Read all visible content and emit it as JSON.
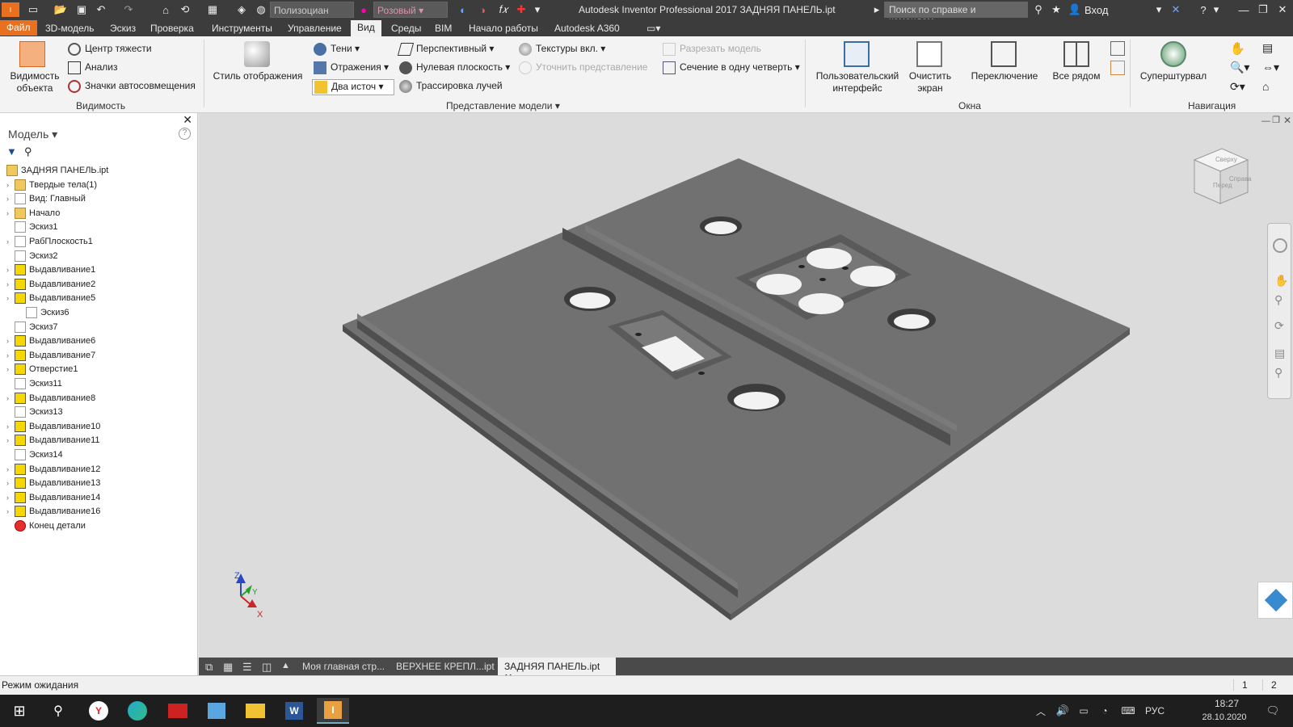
{
  "titlebar": {
    "title": "Autodesk Inventor Professional 2017   ЗАДНЯЯ ПАНЕЛЬ.ipt",
    "material": "Полизоциан",
    "appearance": "Розовый",
    "search_placeholder": "Поиск по справке и командам...",
    "login": "Вход"
  },
  "menu": {
    "tabs": [
      "Файл",
      "3D-модель",
      "Эскиз",
      "Проверка",
      "Инструменты",
      "Управление",
      "Вид",
      "Среды",
      "BIM",
      "Начало работы",
      "Autodesk A360"
    ],
    "active": "Вид"
  },
  "ribbon": {
    "visibility": {
      "object_vis": "Видимость объекта",
      "center_gravity": "Центр тяжести",
      "analysis": "Анализ",
      "autolimits": "Значки автосовмещения",
      "group": "Видимость"
    },
    "display": {
      "style": "Стиль отображения",
      "shadows": "Тени",
      "reflections": "Отражения",
      "lights": "Два источ",
      "perspective": "Перспективный",
      "ground": "Нулевая плоскость",
      "raytrace": "Трассировка лучей",
      "textures": "Текстуры вкл.",
      "refine": "Уточнить представление",
      "half_section": "Разрезать модель",
      "quarter_section": "Сечение в одну четверть",
      "group": "Представление модели"
    },
    "windows": {
      "user_interface": "Пользовательский интерфейс",
      "clean_screen": "Очистить экран",
      "switch": "Переключение",
      "tile": "Все рядом",
      "group": "Окна"
    },
    "navigation": {
      "steering": "Суперштурвал",
      "group": "Навигация"
    }
  },
  "browser": {
    "title": "Модель",
    "items": [
      {
        "label": "ЗАДНЯЯ ПАНЕЛЬ.ipt",
        "icon": "part-icon",
        "exp": false
      },
      {
        "label": "Твердые тела(1)",
        "icon": "folder-icon",
        "exp": true
      },
      {
        "label": "Вид: Главный",
        "icon": "view-icon",
        "exp": true
      },
      {
        "label": "Начало",
        "icon": "folder-icon",
        "exp": true
      },
      {
        "label": "Эскиз1",
        "icon": "sketch-icon",
        "exp": false
      },
      {
        "label": "РабПлоскость1",
        "icon": "plane-icon",
        "exp": true
      },
      {
        "label": "Эскиз2",
        "icon": "sketch-icon",
        "exp": false
      },
      {
        "label": "Выдавливание1",
        "icon": "extrude-icon",
        "exp": true
      },
      {
        "label": "Выдавливание2",
        "icon": "extrude-icon",
        "exp": true
      },
      {
        "label": "Выдавливание5",
        "icon": "extrude-icon",
        "exp": true
      },
      {
        "label": "Эскиз6",
        "icon": "sketch-icon",
        "exp": false
      },
      {
        "label": "Эскиз7",
        "icon": "sketch-icon",
        "exp": false
      },
      {
        "label": "Выдавливание6",
        "icon": "extrude-icon",
        "exp": true
      },
      {
        "label": "Выдавливание7",
        "icon": "extrude-icon",
        "exp": true
      },
      {
        "label": "Отверстие1",
        "icon": "hole-icon",
        "exp": true
      },
      {
        "label": "Эскиз11",
        "icon": "sketch-icon",
        "exp": false
      },
      {
        "label": "Выдавливание8",
        "icon": "extrude-icon",
        "exp": true
      },
      {
        "label": "Эскиз13",
        "icon": "sketch-icon",
        "exp": false
      },
      {
        "label": "Выдавливание10",
        "icon": "extrude-icon",
        "exp": true
      },
      {
        "label": "Выдавливание11",
        "icon": "extrude-icon",
        "exp": true
      },
      {
        "label": "Эскиз14",
        "icon": "sketch-icon",
        "exp": false
      },
      {
        "label": "Выдавливание12",
        "icon": "extrude-icon",
        "exp": true
      },
      {
        "label": "Выдавливание13",
        "icon": "extrude-icon",
        "exp": true
      },
      {
        "label": "Выдавливание14",
        "icon": "extrude-icon",
        "exp": true
      },
      {
        "label": "Выдавливание16",
        "icon": "extrude-icon",
        "exp": true
      },
      {
        "label": "Конец детали",
        "icon": "end-of-part-icon",
        "exp": false
      }
    ]
  },
  "viewcube": {
    "front": "Перед",
    "right": "Справа",
    "top": "Сверху"
  },
  "triad": {
    "x": "X",
    "y": "Y",
    "z": "Z"
  },
  "doc_tabs": [
    "Моя главная стр...",
    "ВЕРХНЕЕ КРЕПЛ...ipt",
    "ЗАДНЯЯ ПАНЕЛЬ.ipt"
  ],
  "status": {
    "text": "Режим ожидания",
    "n1": "1",
    "n2": "2"
  },
  "taskbar": {
    "lang": "РУС",
    "time": "18:27",
    "date": "28.10.2020",
    "notif": "1"
  }
}
